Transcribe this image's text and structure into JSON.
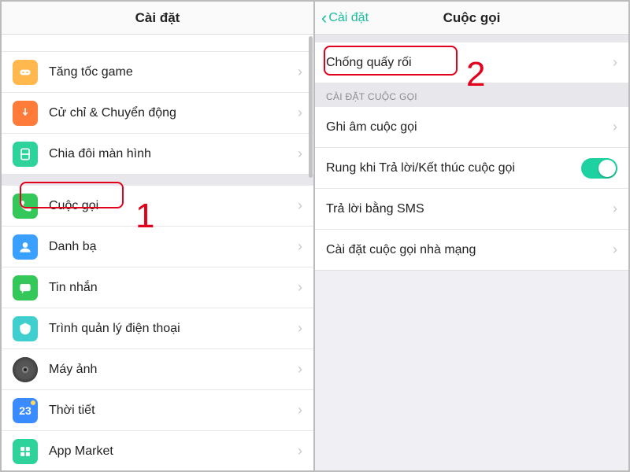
{
  "left": {
    "title": "Cài đặt",
    "items": [
      {
        "label": "Tăng tốc game",
        "icon": "game-icon"
      },
      {
        "label": "Cử chỉ & Chuyển động",
        "icon": "gesture-icon"
      },
      {
        "label": "Chia đôi màn hình",
        "icon": "split-icon"
      },
      {
        "label": "Cuộc gọi",
        "icon": "call-icon"
      },
      {
        "label": "Danh bạ",
        "icon": "contacts-icon"
      },
      {
        "label": "Tin nhắn",
        "icon": "message-icon"
      },
      {
        "label": "Trình quản lý điện thoại",
        "icon": "phonemgr-icon"
      },
      {
        "label": "Máy ảnh",
        "icon": "camera-icon"
      },
      {
        "label": "Thời tiết",
        "icon": "weather-icon",
        "badge": "23"
      },
      {
        "label": "App Market",
        "icon": "market-icon"
      }
    ]
  },
  "right": {
    "back_label": "Cài đặt",
    "title": "Cuộc gọi",
    "top_item": {
      "label": "Chống quấy rối"
    },
    "section_header": "CÀI ĐẶT CUỘC GỌI",
    "items": [
      {
        "label": "Ghi âm cuộc gọi",
        "accessory": "chevron"
      },
      {
        "label": "Rung khi Trả lời/Kết thúc cuộc gọi",
        "accessory": "toggle",
        "toggle_on": true
      },
      {
        "label": "Trả lời bằng SMS",
        "accessory": "chevron"
      },
      {
        "label": "Cài đặt cuộc gọi nhà mạng",
        "accessory": "chevron"
      }
    ]
  },
  "annotations": {
    "marker1": "1",
    "marker2": "2"
  },
  "colors": {
    "accent": "#1abc9c",
    "highlight": "#e2001a"
  }
}
